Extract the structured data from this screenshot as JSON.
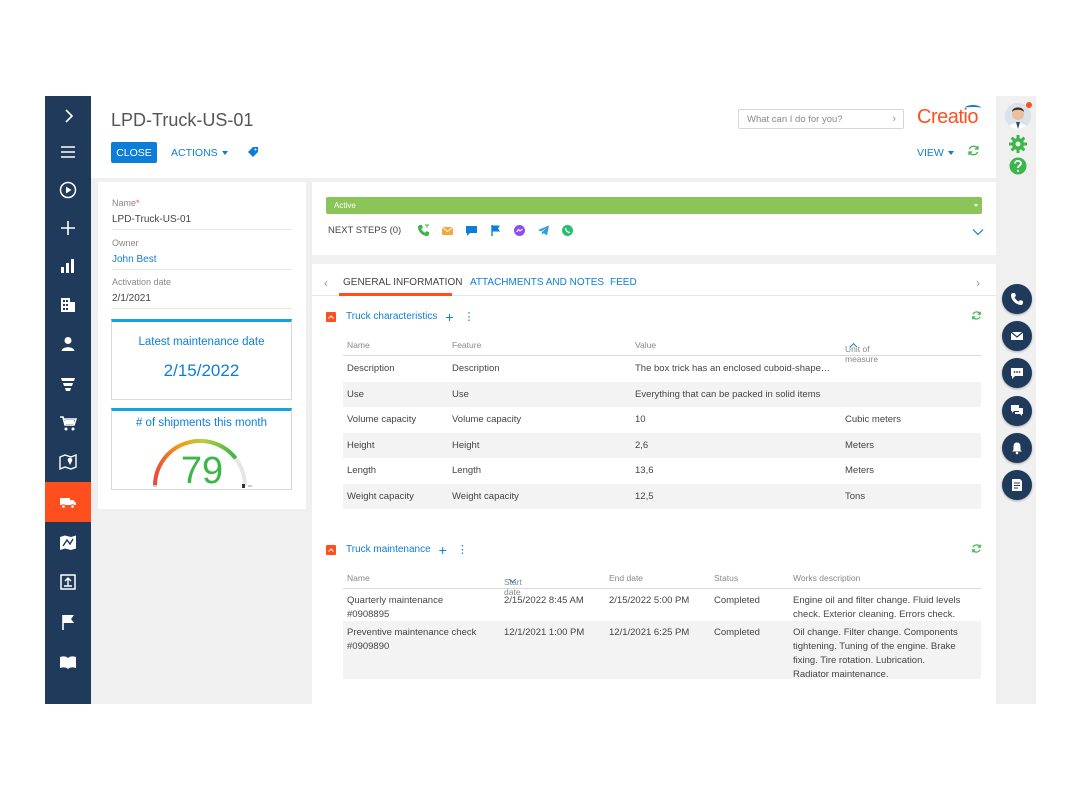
{
  "header": {
    "title": "LPD-Truck-US-01",
    "close_label": "CLOSE",
    "actions_label": "ACTIONS",
    "search_placeholder": "What can I do for you?",
    "logo_text": "Creatio",
    "view_label": "VIEW"
  },
  "sidebar": {
    "items": [
      "expand",
      "menu",
      "play",
      "add",
      "dashboards",
      "accounts",
      "contacts",
      "funnel",
      "cart",
      "map",
      "trucks",
      "route-map",
      "upload",
      "flag",
      "library"
    ],
    "active": "trucks"
  },
  "fields": {
    "name_label": "Name",
    "name_value": "LPD-Truck-US-01",
    "owner_label": "Owner",
    "owner_value": "John Best",
    "activation_label": "Activation date",
    "activation_value": "2/1/2021"
  },
  "widgets": {
    "maintenance_title": "Latest maintenance date",
    "maintenance_value": "2/15/2022",
    "shipments_title": "# of shipments this month",
    "shipments_value": "79",
    "gauge_fraction": 0.79
  },
  "status": {
    "stage": "Active",
    "next_steps": "NEXT STEPS (0)"
  },
  "tabs": [
    {
      "label": "GENERAL INFORMATION",
      "active": true
    },
    {
      "label": "ATTACHMENTS AND NOTES",
      "active": false
    },
    {
      "label": "FEED",
      "active": false
    }
  ],
  "characteristics": {
    "title": "Truck characteristics",
    "columns": [
      "Name",
      "Feature",
      "Value",
      "Unit of measure"
    ],
    "rows": [
      {
        "name": "Description",
        "feature": "Description",
        "value": "The box trick has an enclosed cuboid-shape…",
        "unit": ""
      },
      {
        "name": "Use",
        "feature": "Use",
        "value": "Everything that can be packed in solid items",
        "unit": ""
      },
      {
        "name": "Volume capacity",
        "feature": "Volume capacity",
        "value": "10",
        "unit": "Cubic meters"
      },
      {
        "name": "Height",
        "feature": "Height",
        "value": "2,6",
        "unit": "Meters"
      },
      {
        "name": "Length",
        "feature": "Length",
        "value": "13,6",
        "unit": "Meters"
      },
      {
        "name": "Weight capacity",
        "feature": "Weight capacity",
        "value": "12,5",
        "unit": "Tons"
      }
    ]
  },
  "maintenance": {
    "title": "Truck maintenance",
    "columns": [
      "Name",
      "Start date",
      "End date",
      "Status",
      "Works description"
    ],
    "rows": [
      {
        "name_l1": "Quarterly maintenance",
        "name_l2": "#0908895",
        "start": "2/15/2022 8:45 AM",
        "end": "2/15/2022 5:00 PM",
        "status": "Completed",
        "desc": [
          "Engine oil and filter change. Fluid levels",
          "check. Exterior cleaning. Errors check."
        ]
      },
      {
        "name_l1": "Preventive maintenance check",
        "name_l2": "#0909890",
        "start": "12/1/2021 1:00 PM",
        "end": "12/1/2021 6:25 PM",
        "status": "Completed",
        "desc": [
          "Oil change. Filter change. Components",
          "tightening. Tuning of the engine. Brake",
          "fixing. Tire rotation. Lubrication.",
          "Radiator maintenance."
        ]
      }
    ]
  },
  "colors": {
    "sidebar": "#1f3a5a",
    "accent_orange": "#ff4f1f",
    "link_blue": "#0d7ed8",
    "status_green": "#8bc55a"
  }
}
